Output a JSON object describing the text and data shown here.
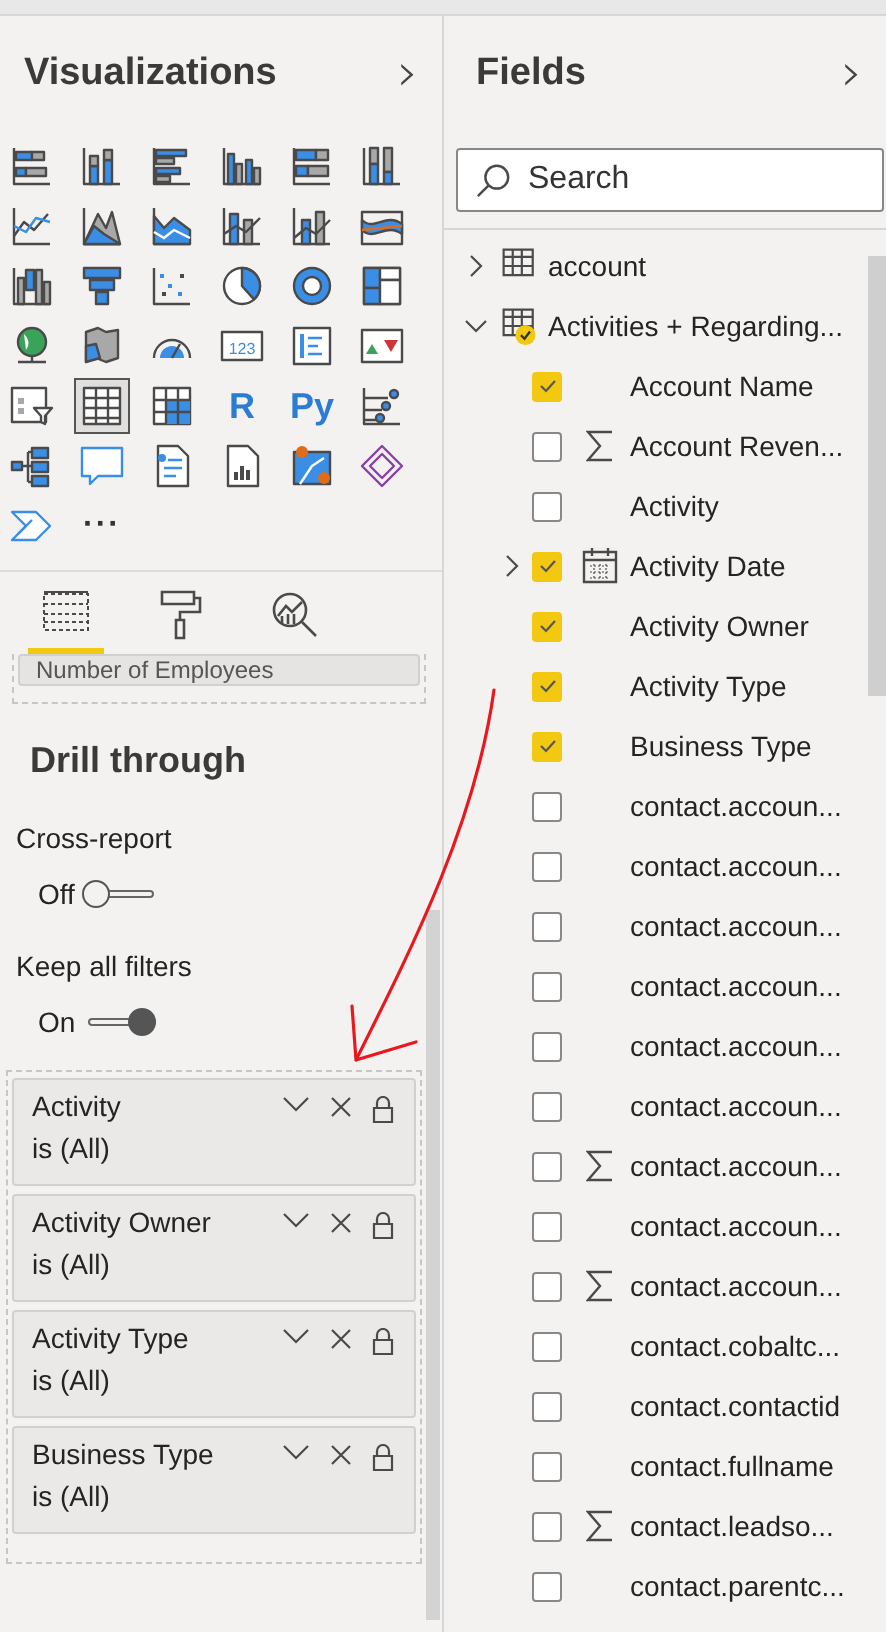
{
  "visualizations": {
    "title": "Visualizations",
    "collapse": "›",
    "gallery": [
      {
        "kind": "stacked-bar",
        "selected": false
      },
      {
        "kind": "stacked-column",
        "selected": false
      },
      {
        "kind": "clustered-bar",
        "selected": false
      },
      {
        "kind": "clustered-column",
        "selected": false
      },
      {
        "kind": "bar-100",
        "selected": false
      },
      {
        "kind": "column-100",
        "selected": false
      },
      {
        "kind": "line",
        "selected": false
      },
      {
        "kind": "area",
        "selected": false
      },
      {
        "kind": "stacked-area",
        "selected": false
      },
      {
        "kind": "line-column",
        "selected": false
      },
      {
        "kind": "line-column-2",
        "selected": false
      },
      {
        "kind": "ribbon",
        "selected": false
      },
      {
        "kind": "waterfall",
        "selected": false
      },
      {
        "kind": "funnel",
        "selected": false
      },
      {
        "kind": "scatter",
        "selected": false
      },
      {
        "kind": "pie",
        "selected": false
      },
      {
        "kind": "donut",
        "selected": false
      },
      {
        "kind": "treemap",
        "selected": false
      },
      {
        "kind": "globe",
        "selected": false
      },
      {
        "kind": "filled-map",
        "selected": false
      },
      {
        "kind": "gauge",
        "selected": false
      },
      {
        "kind": "card",
        "label": "123",
        "selected": false
      },
      {
        "kind": "multirow",
        "selected": false
      },
      {
        "kind": "kpi",
        "selected": false
      },
      {
        "kind": "slicer",
        "selected": false
      },
      {
        "kind": "table",
        "selected": true
      },
      {
        "kind": "matrix",
        "selected": false
      },
      {
        "kind": "script",
        "label": "R",
        "selected": false
      },
      {
        "kind": "script",
        "label": "Py",
        "selected": false
      },
      {
        "kind": "influencers",
        "selected": false
      },
      {
        "kind": "decomposition",
        "selected": false
      },
      {
        "kind": "speech",
        "selected": false
      },
      {
        "kind": "narrative",
        "selected": false
      },
      {
        "kind": "paginated",
        "selected": false
      },
      {
        "kind": "azure-map",
        "selected": false
      },
      {
        "kind": "diamond",
        "selected": false
      },
      {
        "kind": "automate",
        "selected": false
      },
      {
        "kind": "more",
        "label": "···",
        "selected": false
      }
    ],
    "pane_tabs": [
      {
        "kind": "fields",
        "selected": true
      },
      {
        "kind": "format",
        "selected": false
      },
      {
        "kind": "analytics",
        "selected": false
      }
    ],
    "visual_well_field": "Number of Employees",
    "drill_through": {
      "title": "Drill through",
      "settings": [
        {
          "label": "Cross-report",
          "toggle": {
            "label": "Off",
            "on": false
          }
        },
        {
          "label": "Keep all filters",
          "toggle": {
            "label": "On",
            "on": true
          }
        }
      ],
      "filters": [
        {
          "name": "Activity",
          "condition": "is (All)"
        },
        {
          "name": "Activity Owner",
          "condition": "is (All)"
        },
        {
          "name": "Activity Type",
          "condition": "is (All)"
        },
        {
          "name": "Business Type",
          "condition": "is (All)"
        }
      ]
    }
  },
  "fields": {
    "title": "Fields",
    "collapse": "›",
    "search": {
      "placeholder": "Search"
    },
    "tables": [
      {
        "name": "account",
        "expanded": false,
        "has_selected_fields": false
      },
      {
        "name": "Activities + Regarding...",
        "expanded": true,
        "has_selected_fields": true,
        "children": [
          {
            "name": "Account Name",
            "kind": "text",
            "checked": true
          },
          {
            "name": "Account Reven...",
            "kind": "sum",
            "checked": false
          },
          {
            "name": "Activity",
            "kind": "text",
            "checked": false
          },
          {
            "name": "Activity Date",
            "kind": "date",
            "checked": true
          },
          {
            "name": "Activity Owner",
            "kind": "text",
            "checked": true
          },
          {
            "name": "Activity Type",
            "kind": "text",
            "checked": true
          },
          {
            "name": "Business Type",
            "kind": "text",
            "checked": true
          },
          {
            "name": "contact.accoun...",
            "kind": "text",
            "checked": false
          },
          {
            "name": "contact.accoun...",
            "kind": "text",
            "checked": false
          },
          {
            "name": "contact.accoun...",
            "kind": "text",
            "checked": false
          },
          {
            "name": "contact.accoun...",
            "kind": "text",
            "checked": false
          },
          {
            "name": "contact.accoun...",
            "kind": "text",
            "checked": false
          },
          {
            "name": "contact.accoun...",
            "kind": "text",
            "checked": false
          },
          {
            "name": "contact.accoun...",
            "kind": "sum",
            "checked": false
          },
          {
            "name": "contact.accoun...",
            "kind": "text",
            "checked": false
          },
          {
            "name": "contact.accoun...",
            "kind": "sum",
            "checked": false
          },
          {
            "name": "contact.cobaltc...",
            "kind": "text",
            "checked": false
          },
          {
            "name": "contact.contactid",
            "kind": "text",
            "checked": false
          },
          {
            "name": "contact.fullname",
            "kind": "text",
            "checked": false
          },
          {
            "name": "contact.leadso...",
            "kind": "sum",
            "checked": false
          },
          {
            "name": "contact.parentc...",
            "kind": "text",
            "checked": false
          }
        ]
      }
    ]
  }
}
